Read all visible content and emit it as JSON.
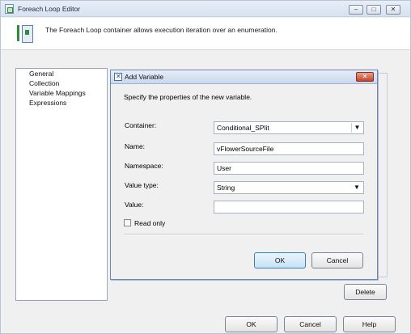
{
  "parent_window": {
    "title": "Foreach Loop Editor",
    "header_text": "The Foreach Loop container allows execution iteration over an enumeration."
  },
  "nav": {
    "items": [
      {
        "label": "General"
      },
      {
        "label": "Collection"
      },
      {
        "label": "Variable Mappings"
      },
      {
        "label": "Expressions"
      }
    ]
  },
  "parent_buttons": {
    "delete": "Delete",
    "ok": "OK",
    "cancel": "Cancel",
    "help": "Help"
  },
  "dialog": {
    "title": "Add Variable",
    "description": "Specify the properties of the new variable.",
    "labels": {
      "container": "Container:",
      "name": "Name:",
      "namespace": "Namespace:",
      "value_type": "Value type:",
      "value": "Value:",
      "read_only": "Read only"
    },
    "values": {
      "container": "Conditional_SPlit",
      "name": "vFlowerSourceFile",
      "namespace": "User",
      "value_type": "String",
      "value": ""
    },
    "read_only_checked": false,
    "buttons": {
      "ok": "OK",
      "cancel": "Cancel"
    }
  }
}
